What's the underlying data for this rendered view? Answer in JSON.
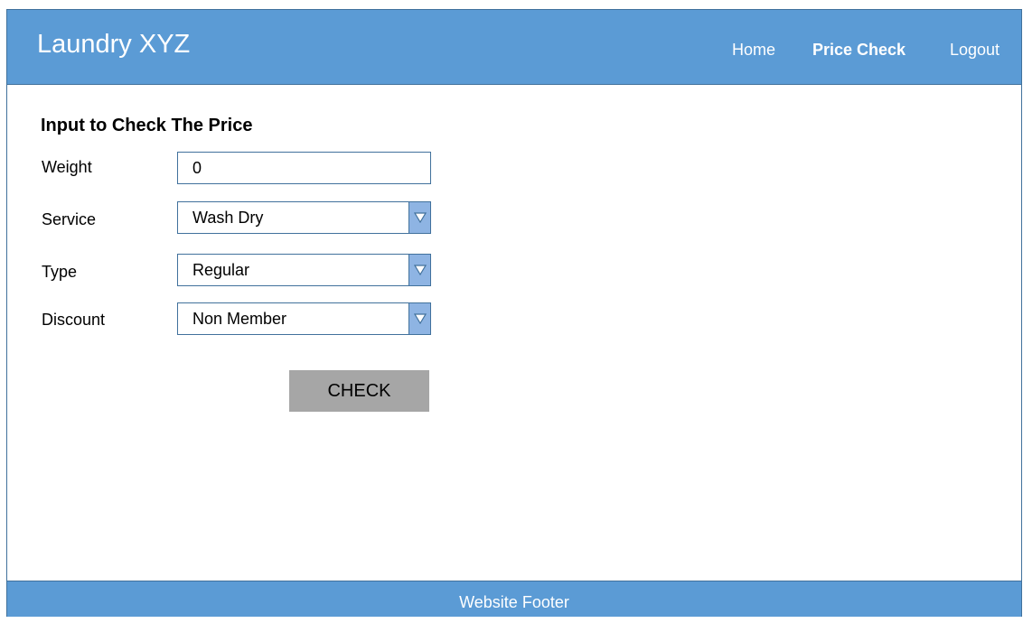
{
  "header": {
    "brand": "Laundry XYZ",
    "nav": [
      {
        "label": "Home",
        "active": false
      },
      {
        "label": "Price Check",
        "active": true
      },
      {
        "label": "Logout",
        "active": false
      }
    ]
  },
  "form": {
    "title": "Input to Check The Price",
    "weight": {
      "label": "Weight",
      "value": "0"
    },
    "service": {
      "label": "Service",
      "value": "Wash Dry"
    },
    "type": {
      "label": "Type",
      "value": "Regular"
    },
    "discount": {
      "label": "Discount",
      "value": "Non Member"
    },
    "submit_label": "CHECK"
  },
  "footer": {
    "text": "Website Footer"
  },
  "colors": {
    "header_bg": "#5b9bd5",
    "border": "#41719c",
    "select_arrow_bg": "#8eb4e3",
    "button_bg": "#a6a6a6"
  },
  "icons": {
    "select_arrow": "triangle-down-icon"
  }
}
